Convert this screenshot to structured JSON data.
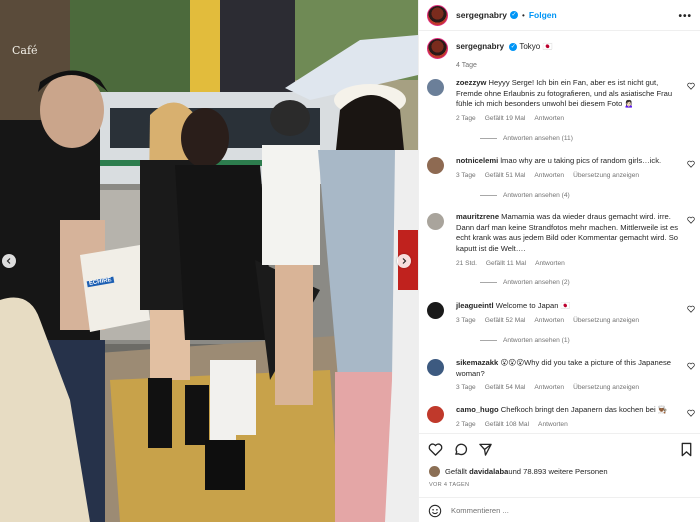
{
  "post": {
    "author": "sergegnabry",
    "follow_label": "Folgen",
    "more_label": "•••",
    "caption": {
      "username": "sergegnabry",
      "text": "Tokyo 🇯🇵",
      "age": "4 Tage"
    }
  },
  "photo": {
    "cafe_sign": "Café",
    "bag_text": "ECHIRE"
  },
  "comments": [
    {
      "username": "zoezzyw",
      "text": "Heyyy Serge! Ich bin ein Fan, aber es ist nicht gut, Fremde ohne Erlaubnis zu fotografieren, und als asiatische Frau fühle ich mich besonders unwohl bei diesem Foto 🙍🏻‍♀️",
      "age": "2 Tage",
      "likes": "Gefällt 19 Mal",
      "reply": "Antworten",
      "translate": "",
      "replies": "Antworten ansehen (11)",
      "avatar_color": "#6b7f99"
    },
    {
      "username": "notnicelemi",
      "text": "lmao why are u taking pics of random girls…ick.",
      "age": "3 Tage",
      "likes": "Gefällt 51 Mal",
      "reply": "Antworten",
      "translate": "Übersetzung anzeigen",
      "replies": "Antworten ansehen (4)",
      "avatar_color": "#8e6a52"
    },
    {
      "username": "mauritzrene",
      "text": "Mamamia was da wieder draus gemacht wird. irre. Dann darf man keine Strandfotos mehr machen. Mittlerweile ist es echt krank was aus jedem Bild oder Kommentar gemacht wird. So kaputt ist die Welt….",
      "age": "21 Std.",
      "likes": "Gefällt 11 Mal",
      "reply": "Antworten",
      "translate": "",
      "replies": "Antworten ansehen (2)",
      "avatar_color": "#a9a49c"
    },
    {
      "username": "jleagueintl",
      "text": "Welcome to Japan 🇯🇵",
      "age": "3 Tage",
      "likes": "Gefällt 52 Mal",
      "reply": "Antworten",
      "translate": "Übersetzung anzeigen",
      "replies": "Antworten ansehen (1)",
      "avatar_color": "#1a1a1a"
    },
    {
      "username": "sikemazakk",
      "text": "😮😮😮Why did you take a picture of this Japanese woman?",
      "age": "3 Tage",
      "likes": "Gefällt 54 Mal",
      "reply": "Antworten",
      "translate": "Übersetzung anzeigen",
      "replies": "",
      "avatar_color": "#3d5a80"
    },
    {
      "username": "camo_hugo",
      "text": "Chefkoch bringt den Japanern das kochen bei 👨🏾‍🍳",
      "age": "2 Tage",
      "likes": "Gefällt 108 Mal",
      "reply": "Antworten",
      "translate": "",
      "replies": "",
      "avatar_color": "#c0392b"
    }
  ],
  "footer": {
    "likes_prefix": "Gefällt ",
    "liked_by": "davidalaba",
    "likes_suffix": " und 78.893 weitere Personen",
    "date": "VOR 4 TAGEN",
    "add_comment_placeholder": "Kommentieren ..."
  },
  "colors": {
    "link": "#0095f6",
    "meta": "#737373",
    "text": "#262626"
  }
}
